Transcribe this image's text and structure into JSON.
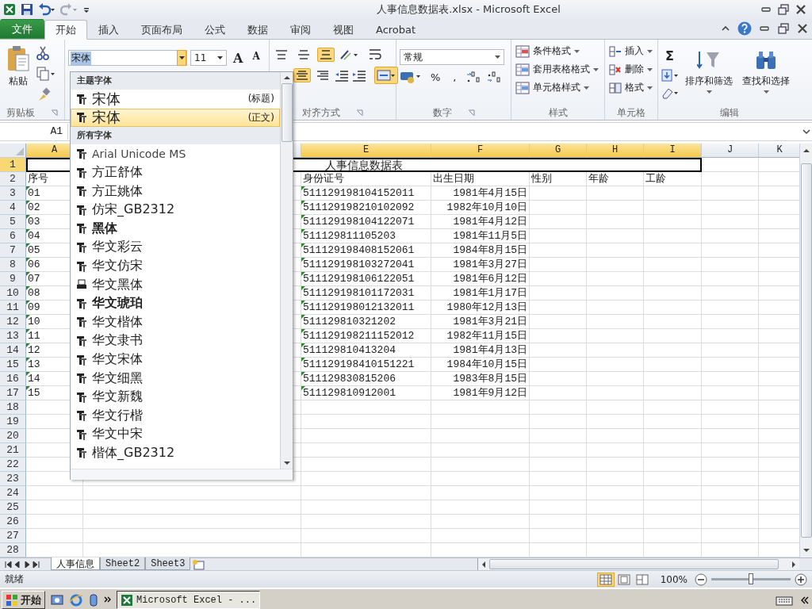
{
  "title_bar": {
    "title": "人事信息数据表.xlsx - Microsoft Excel"
  },
  "ribbon_tabs": [
    {
      "label": "文件",
      "kind": "file",
      "selected": false
    },
    {
      "label": "开始",
      "kind": "tab",
      "selected": true
    },
    {
      "label": "插入",
      "kind": "tab",
      "selected": false
    },
    {
      "label": "页面布局",
      "kind": "tab",
      "selected": false
    },
    {
      "label": "公式",
      "kind": "tab",
      "selected": false
    },
    {
      "label": "数据",
      "kind": "tab",
      "selected": false
    },
    {
      "label": "审阅",
      "kind": "tab",
      "selected": false
    },
    {
      "label": "视图",
      "kind": "tab",
      "selected": false
    },
    {
      "label": "Acrobat",
      "kind": "tab",
      "selected": false
    }
  ],
  "clipboard": {
    "paste": "粘贴",
    "label": "剪贴板"
  },
  "font": {
    "name": "宋体",
    "size": "11",
    "grow": "A",
    "shrink": "A"
  },
  "alignment": {
    "label": "对齐方式",
    "top_row": [
      {
        "kind": "top",
        "selected": false
      },
      {
        "kind": "middle",
        "selected": false
      },
      {
        "kind": "bottom",
        "selected": true
      }
    ],
    "bottom_row": [
      {
        "kind": "center",
        "selected": true
      },
      {
        "kind": "right",
        "selected": false
      }
    ],
    "merge": {
      "selected": true
    }
  },
  "number": {
    "format": "常规",
    "percent": "%",
    "comma": ",",
    "label": "数字"
  },
  "styles": {
    "buttons": [
      "条件格式",
      "套用表格格式",
      "单元格样式"
    ],
    "label": "样式"
  },
  "cells": {
    "buttons": [
      "插入",
      "删除",
      "格式"
    ],
    "label": "单元格"
  },
  "editing": {
    "sum": "Σ",
    "buttons": [
      "排序和筛选",
      "查找和选择"
    ],
    "label": "编辑"
  },
  "name_box": "A1",
  "font_dropdown": {
    "sections": [
      {
        "heading": "主题字体",
        "items": [
          {
            "name": "宋体",
            "tag": "(标题)",
            "kind": "truetype",
            "bold": false,
            "selected": false
          },
          {
            "name": "宋体",
            "tag": "(正文)",
            "kind": "truetype",
            "bold": false,
            "selected": true
          }
        ]
      },
      {
        "heading": "所有字体",
        "items": [
          {
            "name": "Arial Unicode MS",
            "kind": "truetype",
            "bold": false,
            "selected": false
          },
          {
            "name": "方正舒体",
            "kind": "truetype",
            "bold": false,
            "selected": false
          },
          {
            "name": "方正姚体",
            "kind": "truetype",
            "bold": false,
            "selected": false
          },
          {
            "name": "仿宋_GB2312",
            "kind": "truetype",
            "bold": false,
            "selected": false
          },
          {
            "name": "黑体",
            "kind": "truetype",
            "bold": true,
            "selected": false
          },
          {
            "name": "华文彩云",
            "kind": "truetype",
            "bold": false,
            "selected": false
          },
          {
            "name": "华文仿宋",
            "kind": "truetype",
            "bold": false,
            "selected": false
          },
          {
            "name": "华文黑体",
            "kind": "printer",
            "bold": false,
            "selected": false
          },
          {
            "name": "华文琥珀",
            "kind": "truetype",
            "bold": true,
            "selected": false
          },
          {
            "name": "华文楷体",
            "kind": "truetype",
            "bold": false,
            "selected": false
          },
          {
            "name": "华文隶书",
            "kind": "truetype",
            "bold": false,
            "selected": false
          },
          {
            "name": "华文宋体",
            "kind": "truetype",
            "bold": false,
            "selected": false
          },
          {
            "name": "华文细黑",
            "kind": "truetype",
            "bold": false,
            "selected": false
          },
          {
            "name": "华文新魏",
            "kind": "truetype",
            "bold": false,
            "selected": false
          },
          {
            "name": "华文行楷",
            "kind": "truetype",
            "bold": false,
            "selected": false
          },
          {
            "name": "华文中宋",
            "kind": "truetype",
            "bold": false,
            "selected": false
          },
          {
            "name": "楷体_GB2312",
            "kind": "truetype",
            "bold": false,
            "selected": false
          }
        ]
      }
    ]
  },
  "sheet": {
    "columns": [
      {
        "letter": "A",
        "selected": true
      },
      {
        "letter": "E",
        "selected": true
      },
      {
        "letter": "F",
        "selected": true
      },
      {
        "letter": "G",
        "selected": true
      },
      {
        "letter": "H",
        "selected": true
      },
      {
        "letter": "I",
        "selected": true
      },
      {
        "letter": "J",
        "selected": false
      },
      {
        "letter": "K",
        "selected": false
      }
    ],
    "title_row": {
      "num": "1",
      "selected": true,
      "title": "人事信息数据表"
    },
    "header_row": {
      "num": "2",
      "selected": false,
      "cells": [
        "序号",
        "身份证号",
        "出生日期",
        "性别",
        "年龄",
        "工龄"
      ]
    },
    "data_rows": [
      {
        "num": "3",
        "selected": false,
        "no": "01",
        "id_card": "511129198104152011",
        "birth_date": "1981年4月15日",
        "flagged": true
      },
      {
        "num": "4",
        "selected": false,
        "no": "02",
        "id_card": "511129198210102092",
        "birth_date": "1982年10月10日",
        "flagged": true
      },
      {
        "num": "5",
        "selected": false,
        "no": "03",
        "id_card": "511129198104122071",
        "birth_date": "1981年4月12日",
        "flagged": true
      },
      {
        "num": "6",
        "selected": false,
        "no": "04",
        "id_card": "511129811105203",
        "birth_date": "1981年11月5日",
        "flagged": true
      },
      {
        "num": "7",
        "selected": false,
        "no": "05",
        "id_card": "511129198408152061",
        "birth_date": "1984年8月15日",
        "flagged": true
      },
      {
        "num": "8",
        "selected": false,
        "no": "06",
        "id_card": "511129198103272041",
        "birth_date": "1981年3月27日",
        "flagged": true
      },
      {
        "num": "9",
        "selected": false,
        "no": "07",
        "id_card": "511129198106122051",
        "birth_date": "1981年6月12日",
        "flagged": true
      },
      {
        "num": "10",
        "selected": false,
        "no": "08",
        "id_card": "511129198101172031",
        "birth_date": "1981年1月17日",
        "flagged": true
      },
      {
        "num": "11",
        "selected": false,
        "no": "09",
        "id_card": "511129198012132011",
        "birth_date": "1980年12月13日",
        "flagged": true
      },
      {
        "num": "12",
        "selected": false,
        "no": "10",
        "id_card": "511129810321202",
        "birth_date": "1981年3月21日",
        "flagged": true
      },
      {
        "num": "13",
        "selected": false,
        "no": "11",
        "id_card": "511129198211152012",
        "birth_date": "1982年11月15日",
        "flagged": true
      },
      {
        "num": "14",
        "selected": false,
        "no": "12",
        "id_card": "511129810413204",
        "birth_date": "1981年4月13日",
        "flagged": true
      },
      {
        "num": "15",
        "selected": false,
        "no": "13",
        "id_card": "511129198410151221",
        "birth_date": "1984年10月15日",
        "flagged": true
      },
      {
        "num": "16",
        "selected": false,
        "no": "14",
        "id_card": "511129830815206",
        "birth_date": "1983年8月15日",
        "flagged": true
      },
      {
        "num": "17",
        "selected": false,
        "no": "15",
        "id_card": "511129810912001",
        "birth_date": "1981年9月12日",
        "flagged": true
      }
    ],
    "empty_rows": [
      {
        "num": "18",
        "selected": false
      },
      {
        "num": "19",
        "selected": false
      },
      {
        "num": "20",
        "selected": false
      },
      {
        "num": "21",
        "selected": false
      },
      {
        "num": "22",
        "selected": false
      },
      {
        "num": "23",
        "selected": false
      },
      {
        "num": "24",
        "selected": false
      },
      {
        "num": "25",
        "selected": false
      },
      {
        "num": "26",
        "selected": false
      },
      {
        "num": "27",
        "selected": false
      },
      {
        "num": "28",
        "selected": false
      }
    ]
  },
  "sheet_tabs": [
    {
      "label": "人事信息",
      "selected": true
    },
    {
      "label": "Sheet2",
      "selected": false
    },
    {
      "label": "Sheet3",
      "selected": false
    }
  ],
  "status_bar": {
    "status": "就绪",
    "zoom": "100%",
    "zoom_slider": {
      "level": 0.5
    }
  },
  "taskbar": {
    "start": "开始",
    "tasks": [
      "Microsoft Excel - ..."
    ]
  }
}
